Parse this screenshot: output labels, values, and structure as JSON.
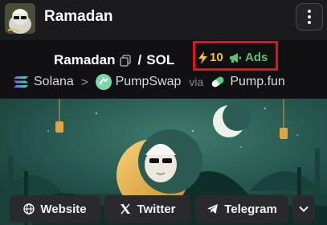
{
  "header": {
    "title": "Ramadan",
    "avatar_icon": "cat-avatar-icon",
    "menu_icon": "vertical-dots-icon"
  },
  "token": {
    "name": "Ramadan",
    "separator": "/",
    "quote": "SOL",
    "boost_count": "10",
    "ads_label": "Ads"
  },
  "route": {
    "chain": "Solana",
    "dex": "PumpSwap",
    "dex_badge": "SWAP",
    "via": "via",
    "source": "Pump.fun"
  },
  "actions": {
    "website": "Website",
    "twitter": "Twitter",
    "telegram": "Telegram"
  },
  "colors": {
    "highlight": "#e3141b",
    "boost": "#f2c230",
    "ads": "#5cc36a"
  }
}
